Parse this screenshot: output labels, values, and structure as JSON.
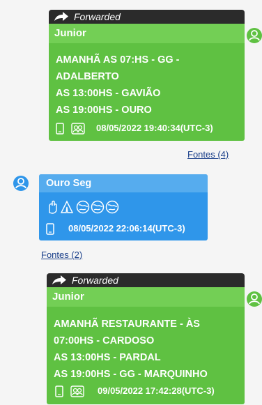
{
  "colors": {
    "green_body": "#5fc142",
    "green_head": "#73cf55",
    "blue_body": "#2f96ea",
    "blue_head": "#56acee",
    "forward_bar": "#2b2b2b",
    "link": "#1a3f8a"
  },
  "messages": [
    {
      "forwarded_label": "Forwarded",
      "sender": "Junior",
      "lines": [
        "AMANHÃ AS 07:HS - GG -",
        "ADALBERTO",
        "AS 13:00HS - GAVIÃO",
        "AS 19:00HS - OURO"
      ],
      "timestamp": "08/05/2022 19:40:34(UTC-3)",
      "sources_link": "Fontes (4)",
      "icons": [
        "phone-icon",
        "contacts-icon",
        "user-icon"
      ]
    },
    {
      "sender": "Ouro Seg",
      "emoji_row": [
        "emoji-hand-icon",
        "emoji-pray-icon",
        "emoji-globe-icon",
        "emoji-globe-icon",
        "emoji-globe-icon"
      ],
      "timestamp": "08/05/2022 22:06:14(UTC-3)",
      "sources_link": "Fontes (2)",
      "icons": [
        "phone-icon",
        "user-icon"
      ]
    },
    {
      "forwarded_label": "Forwarded",
      "sender": "Junior",
      "lines": [
        "AMANHÃ RESTAURANTE - ÀS",
        "07:00HS - CARDOSO",
        "AS 13:00HS - PARDAL",
        "AS 19:00HS - GG - MARQUINHO"
      ],
      "timestamp": "09/05/2022 17:42:28(UTC-3)",
      "icons": [
        "phone-icon",
        "contacts-icon",
        "user-icon"
      ]
    }
  ]
}
